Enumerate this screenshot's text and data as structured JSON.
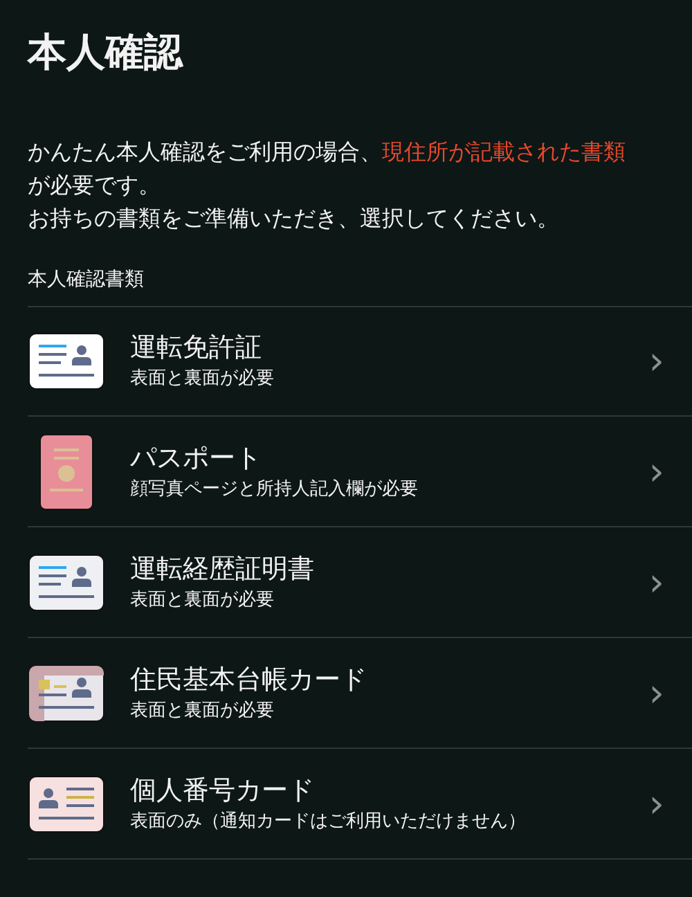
{
  "title": "本人確認",
  "intro": [
    {
      "text": "かんたん本人確認をご利用の場合、",
      "highlight": false
    },
    {
      "text": "現住所が記載された書類",
      "highlight": true
    },
    {
      "text": "が必要です。",
      "highlight": false
    }
  ],
  "instruction": "お持ちの書類をご準備いただき、選択してください。",
  "section_label": "本人確認書類",
  "documents": [
    {
      "kind": "license",
      "name": "運転免許証",
      "note": "表面と裏面が必要",
      "chevron": "›"
    },
    {
      "kind": "passport",
      "name": "パスポート",
      "note": "顔写真ページと所持人記入欄が必要",
      "chevron": "›"
    },
    {
      "kind": "history",
      "name": "運転経歴証明書",
      "note": "表面と裏面が必要",
      "chevron": "›"
    },
    {
      "kind": "resident",
      "name": "住民基本台帳カード",
      "note": "表面と裏面が必要",
      "chevron": "›"
    },
    {
      "kind": "mynumber",
      "name": "個人番号カード",
      "note": "表面のみ（通知カードはご利用いただけません）",
      "chevron": "›"
    }
  ]
}
